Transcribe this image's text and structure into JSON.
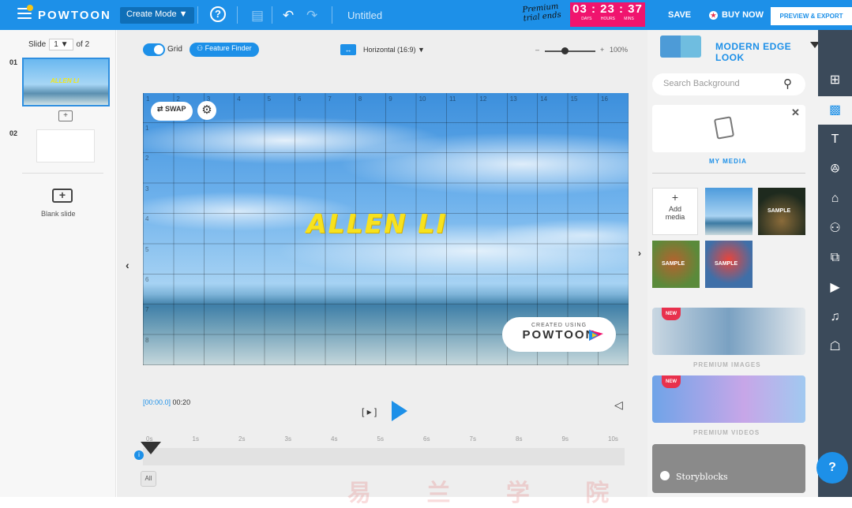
{
  "topbar": {
    "logo": "POWTOON",
    "mode": "Create Mode ▼",
    "help": "?",
    "title": "Untitled",
    "premium_line1": "Premium",
    "premium_line2": "trial ends",
    "timer": "03 : 23 : 37",
    "timer_units": "DAYS HOURS MINS",
    "save": "SAVE",
    "buy": "BUY NOW",
    "buy_icon": "★",
    "preview": "PREVIEW & EXPORT"
  },
  "left": {
    "slide_label": "Slide",
    "slide_current": "1 ▼",
    "slide_total": "of 2",
    "slide1_num": "01",
    "slide1_text": "ALLEN LI",
    "slide2_num": "02",
    "blank_label": "Blank slide"
  },
  "stage": {
    "grid_label": "Grid",
    "feature_finder": "Feature Finder",
    "orientation": "Horizontal (16:9)",
    "zoom_minus": "–",
    "zoom_plus": "+",
    "zoom": "100%",
    "swap": "⇄ SWAP",
    "name": "ALLEN LI",
    "badge_created": "CREATED USING",
    "badge_brand": "POWTOON",
    "grid_cols": [
      "1",
      "2",
      "3",
      "4",
      "5",
      "6",
      "7",
      "8",
      "9",
      "10",
      "11",
      "12",
      "13",
      "14",
      "15",
      "16"
    ],
    "grid_rows": [
      "1",
      "2",
      "3",
      "4",
      "5",
      "6",
      "7",
      "8"
    ]
  },
  "timeline": {
    "current": "[00:00.0]",
    "total": "00:20",
    "ticks": [
      "0s",
      "1s",
      "2s",
      "3s",
      "4s",
      "5s",
      "6s",
      "7s",
      "8s",
      "9s",
      "10s"
    ],
    "all": "All"
  },
  "right": {
    "look": "MODERN EDGE LOOK",
    "search_placeholder": "Search Background",
    "my_media": "MY MEDIA",
    "add_media_line1": "Add",
    "add_media_line2": "media",
    "sample": "SAMPLE",
    "new": "NEW",
    "premium_images": "PREMIUM IMAGES",
    "premium_videos": "PREMIUM VIDEOS",
    "storyblocks": "Storyblocks"
  },
  "rail": {
    "items": [
      "⊞",
      "▩",
      "T",
      "ꔮ",
      "⌂",
      "⚇",
      "⧉",
      "▶",
      "♫",
      "☖"
    ]
  },
  "watermark": "易 兰 学 院"
}
